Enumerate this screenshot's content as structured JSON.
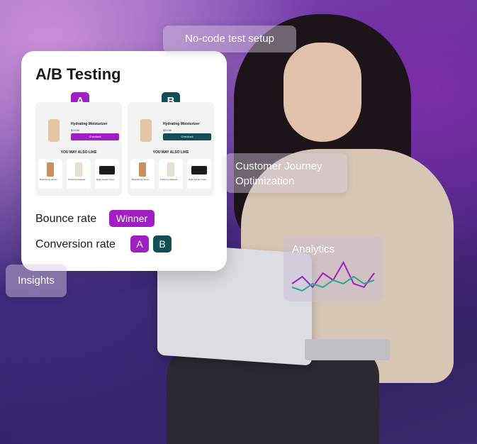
{
  "card": {
    "title": "A/B Testing",
    "variant_a": {
      "badge": "A",
      "product_name": "Hydrating Moisturizer",
      "price": "$24.00",
      "button": "Checkout",
      "also_like": "YOU MAY ALSO LIKE",
      "minis": [
        "Brightening Serum",
        "Purifying Cleanser",
        "Night Facial Cream"
      ],
      "mini_prices": [
        "$38.00",
        "$28.00",
        "$42.00"
      ]
    },
    "variant_b": {
      "badge": "B",
      "product_name": "Hydrating Moisturizer",
      "price": "$24.00",
      "button": "Checkout",
      "also_like": "YOU MAY ALSO LIKE",
      "minis": [
        "Brightening Serum",
        "Purifying Cleanser",
        "Night Facial Cream"
      ],
      "mini_prices": [
        "$38.00",
        "$28.00",
        "$42.00"
      ]
    },
    "bounce_label": "Bounce rate",
    "bounce_pill": "Winner",
    "conversion_label": "Conversion rate",
    "conversion_a": "A",
    "conversion_b": "B"
  },
  "tags": {
    "nocode": "No-code test setup",
    "journey_line1": "Customer Journey",
    "journey_line2": "Optimization",
    "insights": "Insights",
    "analytics": "Analytics"
  },
  "colors": {
    "accent_purple": "#a01fc4",
    "accent_teal": "#144e54"
  },
  "analytics_chart": {
    "series": [
      {
        "values": [
          3,
          5,
          2,
          6,
          4,
          9,
          3,
          2,
          6
        ]
      },
      {
        "values": [
          2,
          1,
          3,
          2,
          4,
          3,
          5,
          3,
          4
        ]
      }
    ]
  }
}
